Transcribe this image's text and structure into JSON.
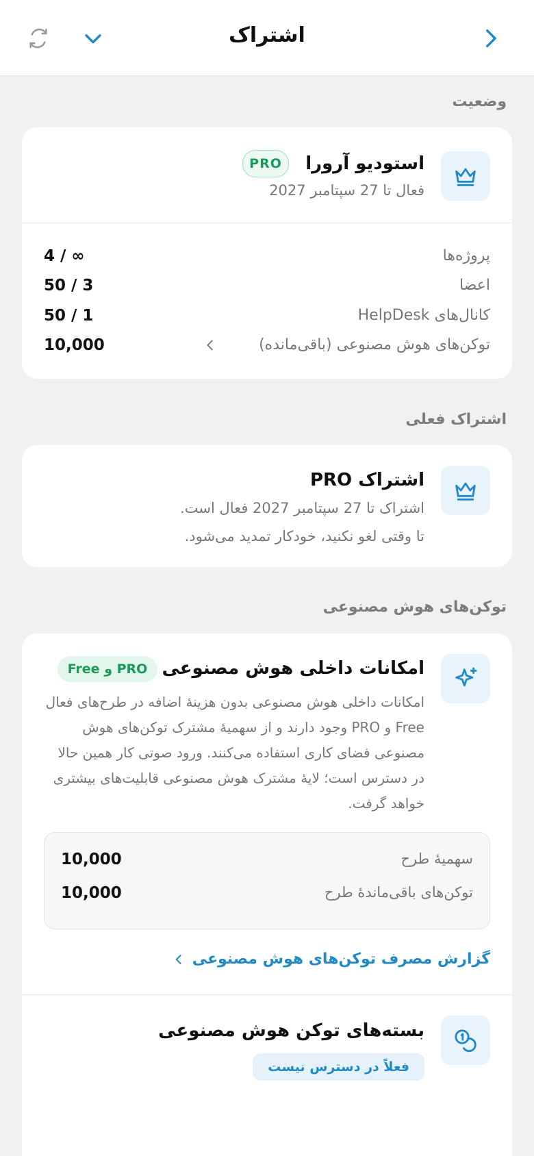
{
  "header": {
    "title": "اشتراک"
  },
  "status_section": {
    "label": "وضعیت",
    "workspace_name": "استودیو آرورا",
    "plan_badge": "PRO",
    "active_until": "فعال تا 27 سپتامبر 2027",
    "stats": [
      {
        "label": "پروژه‌ها",
        "value": "4 / ∞"
      },
      {
        "label": "اعضا",
        "value": "50 / 3"
      },
      {
        "label": "کانال‌های HelpDesk",
        "value": "50 / 1"
      },
      {
        "label": "توکن‌های هوش مصنوعی (باقی‌مانده)",
        "value": "10,000"
      }
    ]
  },
  "current_section": {
    "label": "اشتراک فعلی",
    "title": "اشتراک PRO",
    "line1": "اشتراک تا 27 سپتامبر 2027 فعال است.",
    "line2": "تا وقتی لغو نکنید، خودکار تمدید می‌شود."
  },
  "ai_section": {
    "label": "توکن‌های هوش مصنوعی",
    "title": "امکانات داخلی هوش مصنوعی",
    "badge": "Free و PRO",
    "description": "امکانات داخلی هوش مصنوعی بدون هزینهٔ اضافه در طرح‌های فعال Free و PRO وجود دارند و از سهمیهٔ مشترک توکن‌های هوش مصنوعی فضای کاری استفاده می‌کنند. ورود صوتی کار همین حالا در دسترس است؛ لایهٔ مشترک هوش مصنوعی قابلیت‌های بیشتری خواهد گرفت.",
    "quota": [
      {
        "label": "سهمیهٔ طرح",
        "value": "10,000"
      },
      {
        "label": "توکن‌های باقی‌ماندهٔ طرح",
        "value": "10,000"
      }
    ],
    "usage_link": "گزارش مصرف توکن‌های هوش مصنوعی",
    "packs_title": "بسته‌های توکن هوش مصنوعی",
    "packs_badge": "فعلاً در دسترس نیست"
  },
  "colors": {
    "accent": "#2289c7",
    "badge_green": "#1a9a5a",
    "background": "#f1f1f1"
  },
  "icons": {
    "refresh": "refresh-icon",
    "collapse": "chevron-down-icon",
    "back": "chevron-right-icon",
    "plan": "crown-icon",
    "ai": "sparkle-icon",
    "packs": "coins-icon"
  }
}
